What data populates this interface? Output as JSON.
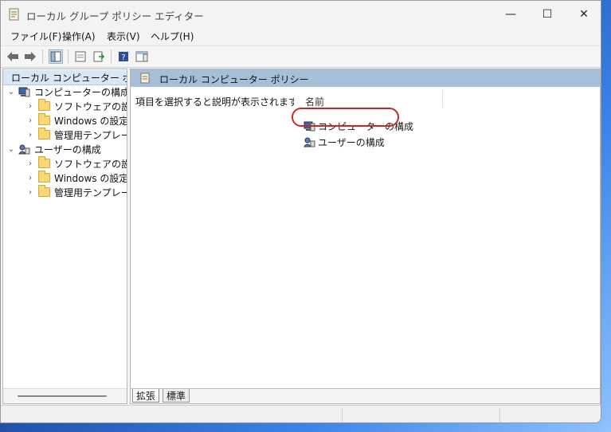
{
  "window": {
    "title": "ローカル グループ ポリシー エディター"
  },
  "window_controls": {
    "minimize": "—",
    "maximize": "☐",
    "close": "✕"
  },
  "menu": [
    "ファイル(F)",
    "操作(A)",
    "表示(V)",
    "ヘルプ(H)"
  ],
  "toolbar": {
    "buttons": [
      "back-arrow-icon",
      "forward-arrow-icon",
      "show-hide-tree-icon",
      "properties-icon",
      "export-list-icon",
      "help-icon",
      "show-hide-action-pane-icon"
    ]
  },
  "tree": {
    "root": "ローカル コンピューター ポリシー",
    "computer_config": {
      "label": "コンピューターの構成",
      "children": [
        "ソフトウェアの設定",
        "Windows の設定",
        "管理用テンプレート"
      ]
    },
    "user_config": {
      "label": "ユーザーの構成",
      "children": [
        "ソフトウェアの設定",
        "Windows の設定",
        "管理用テンプレート"
      ]
    }
  },
  "right_pane": {
    "header": "ローカル コンピューター ポリシー",
    "description": "項目を選択すると説明が表示されます。",
    "column_name": "名前",
    "items": [
      "コンピューターの構成",
      "ユーザーの構成"
    ]
  },
  "tabs": {
    "extended": "拡張",
    "standard": "標準"
  },
  "colors": {
    "header_bar": "#a5bfd9",
    "highlight_ring": "#c62828",
    "folder": "#f8d775"
  }
}
